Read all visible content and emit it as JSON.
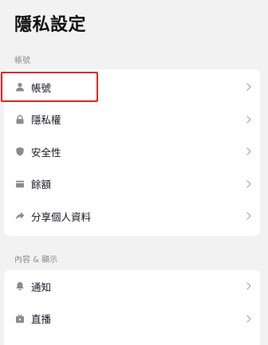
{
  "page": {
    "title": "隱私設定"
  },
  "sections": [
    {
      "label": "帳號",
      "items": [
        {
          "label": "帳號",
          "icon": "person-icon"
        },
        {
          "label": "隱私權",
          "icon": "lock-icon"
        },
        {
          "label": "安全性",
          "icon": "shield-icon"
        },
        {
          "label": "餘額",
          "icon": "wallet-icon"
        },
        {
          "label": "分享個人資料",
          "icon": "share-icon"
        }
      ]
    },
    {
      "label": "內容 & 顯示",
      "items": [
        {
          "label": "通知",
          "icon": "bell-icon"
        },
        {
          "label": "直播",
          "icon": "live-tv-icon"
        }
      ]
    }
  ],
  "colors": {
    "background": "#f2f2f2",
    "card": "#ffffff",
    "icon": "#8a8b91",
    "highlight": "#e5231c"
  }
}
